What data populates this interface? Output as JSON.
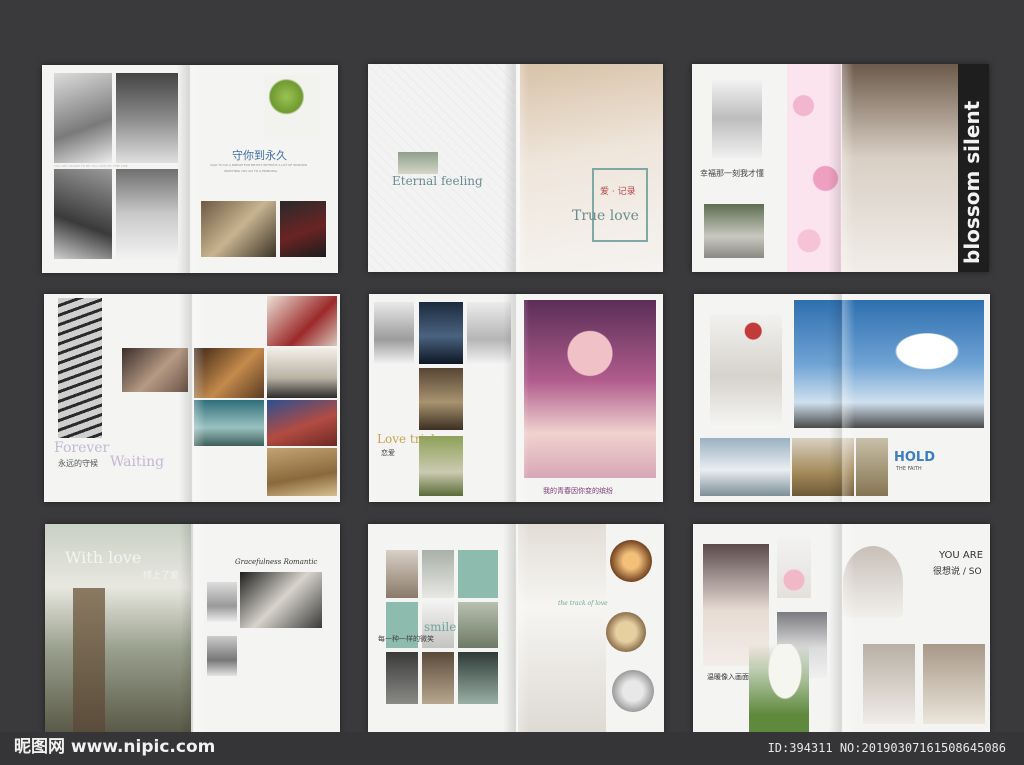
{
  "spreads": [
    {
      "id": "s1",
      "texts": {
        "cn_title": "守你到永久",
        "line1": "CIAO TU DO A DREAM FOR ME PUT WITHOUT A LOT OF SHADOW",
        "line2": "WATCHING YOU GO TO A PRINCIPAL",
        "line3": "YOU ARE CROWD TO BE YOU LOOK MY TIME LINE"
      }
    },
    {
      "id": "s2",
      "texts": {
        "eternal": "Eternal feeling",
        "love_cn": "爱 · 记录",
        "true_love": "True love"
      }
    },
    {
      "id": "s3",
      "texts": {
        "cn_line": "幸福那一刻我才懂",
        "vertical": "blossom silent"
      }
    },
    {
      "id": "s4",
      "texts": {
        "forever": "Forever",
        "waiting": "Waiting",
        "cn_line": "永远的守候"
      }
    },
    {
      "id": "s5",
      "texts": {
        "love_trick": "Love    trick",
        "cn_love": "恋爱",
        "cn_caption": "我的青春因你变的缤纷"
      }
    },
    {
      "id": "s6",
      "texts": {
        "hold": "HOLD",
        "faith": "THE FAITH"
      }
    },
    {
      "id": "s7",
      "texts": {
        "with_love": "With love",
        "cn_line": "倾上了爱",
        "script": "Gracefulness Romantic"
      }
    },
    {
      "id": "s8",
      "texts": {
        "smile": "smile",
        "cn_line": "每一种一样的微笑",
        "script": "the track of love"
      }
    },
    {
      "id": "s9",
      "texts": {
        "you_are": "YOU ARE",
        "cn_so": "很想说 / SO",
        "cn_caption": "温暖像入画面"
      }
    }
  ],
  "watermark": {
    "logo": "昵图网 www.nipic.com",
    "credit": "ID:394311 NO:20190307161508645086"
  }
}
